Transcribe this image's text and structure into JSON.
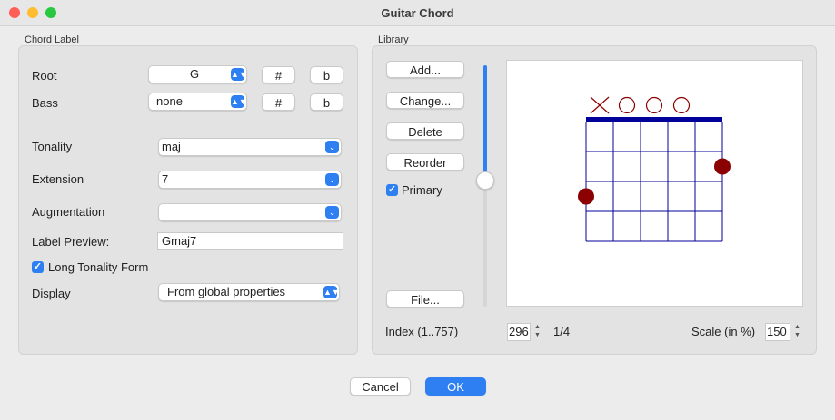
{
  "window": {
    "title": "Guitar Chord"
  },
  "colors": {
    "accent": "#2d7ff2",
    "close": "#ff5f57",
    "minimize": "#febc2e",
    "zoom": "#28c840",
    "diagram": "#00009a",
    "dot": "#8b0000"
  },
  "chord_label": {
    "group_title": "Chord Label",
    "root": {
      "label": "Root",
      "value": "G",
      "sharp": "#",
      "flat": "b"
    },
    "bass": {
      "label": "Bass",
      "value": "none",
      "sharp": "#",
      "flat": "b"
    },
    "tonality": {
      "label": "Tonality",
      "value": "maj"
    },
    "extension": {
      "label": "Extension",
      "value": "7"
    },
    "augmentation": {
      "label": "Augmentation",
      "value": ""
    },
    "preview": {
      "label": "Label Preview:",
      "value": "Gmaj7"
    },
    "long_tonality": {
      "label": "Long Tonality Form",
      "checked": true
    },
    "display": {
      "label": "Display",
      "value": "From global properties"
    }
  },
  "library": {
    "group_title": "Library",
    "buttons": {
      "add": "Add...",
      "change": "Change...",
      "delete": "Delete",
      "reorder": "Reorder",
      "file": "File..."
    },
    "primary": {
      "label": "Primary",
      "checked": true
    },
    "index_label": "Index (1..757)",
    "index_value": "296",
    "page": "1/4",
    "scale_label": "Scale (in %)",
    "scale_value": "150",
    "slider_level": 0.65
  },
  "chord_diagram": {
    "strings": 6,
    "frets": 4,
    "open_markers": [
      "X",
      "O",
      "O",
      "O",
      "",
      ""
    ],
    "dots": [
      {
        "string": 1,
        "fret": 3
      },
      {
        "string": 6,
        "fret": 2
      }
    ]
  },
  "footer": {
    "cancel": "Cancel",
    "ok": "OK"
  }
}
